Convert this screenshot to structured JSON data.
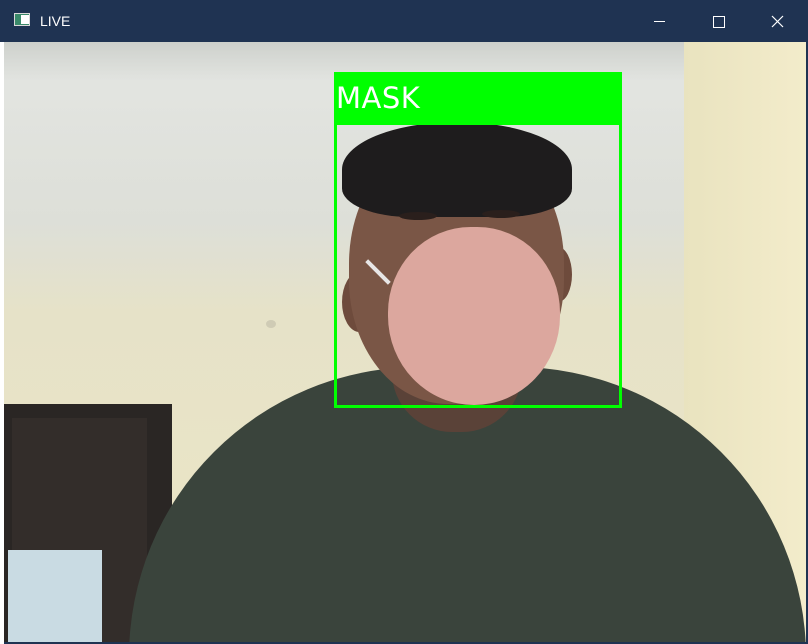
{
  "window": {
    "title": "LIVE",
    "buttons": {
      "minimize": "minimize-icon",
      "maximize": "maximize-icon",
      "close": "close-icon"
    }
  },
  "detection": {
    "label": "MASK",
    "color": "#00ff00"
  },
  "colors": {
    "titlebar": "#1f3352",
    "detection_box": "#00ff00"
  }
}
